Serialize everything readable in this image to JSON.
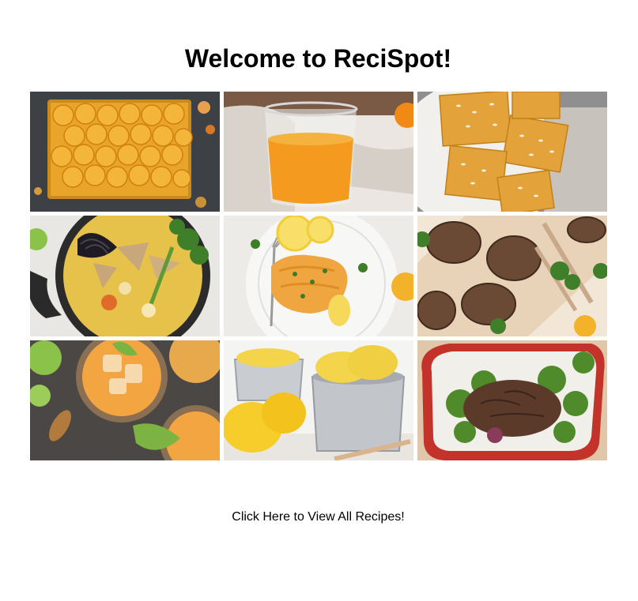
{
  "page": {
    "title": "Welcome to ReciSpot!",
    "cta_label": "Click Here to View All Recipes!"
  },
  "gallery": {
    "tiles": [
      {
        "subject": "orange-slice-tray-cake"
      },
      {
        "subject": "orange-juice-glass"
      },
      {
        "subject": "cornbread-squares-pine-nuts"
      },
      {
        "subject": "curry-noodle-pot"
      },
      {
        "subject": "fish-fillet-lemon-plate"
      },
      {
        "subject": "grilled-lamb-chops"
      },
      {
        "subject": "iced-turmeric-lime-drinks"
      },
      {
        "subject": "lemon-sorbet-cups"
      },
      {
        "subject": "shredded-beef-salad-dish"
      }
    ]
  },
  "colors": {
    "background": "#ffffff",
    "text": "#000000",
    "orange": "#f2a01c",
    "dark_slate": "#3d4044",
    "lemon": "#f5d84a",
    "greens": "#4f8a2b",
    "meat_brown": "#5b3a2a",
    "dish_red": "#c3332a"
  }
}
